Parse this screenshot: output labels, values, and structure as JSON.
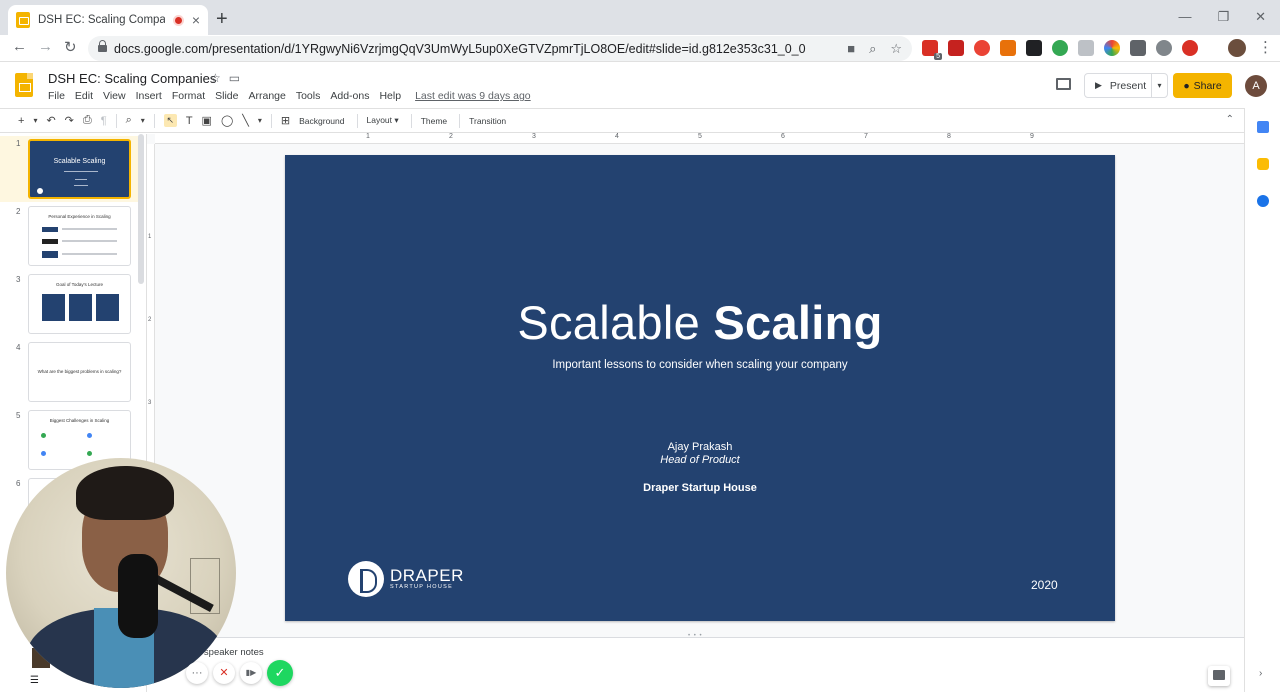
{
  "browser": {
    "tab_title": "DSH EC: Scaling Companies",
    "tab_close": "×",
    "new_tab": "+",
    "window_controls": [
      "—",
      "❐",
      "✕"
    ],
    "nav": {
      "back": "←",
      "forward": "→",
      "reload": "↻"
    },
    "url": "docs.google.com/presentation/d/1YRgwyNi6VzrjmgQqV3UmWyL5up0XeGTVZpmrTjLO8OE/edit#slide=id.g812e353c31_0_0",
    "omnibox_icons": [
      "■",
      "⌕",
      "☆"
    ],
    "extension_badge": "5",
    "menu": "⋮"
  },
  "app": {
    "doc_title": "DSH EC: Scaling Companies",
    "star": "☆",
    "folder": "▭",
    "menus": [
      "File",
      "Edit",
      "View",
      "Insert",
      "Format",
      "Slide",
      "Arrange",
      "Tools",
      "Add-ons",
      "Help"
    ],
    "last_edit": "Last edit was 9 days ago",
    "present_label": "Present",
    "present_caret": "▾",
    "share_label": "Share",
    "avatar_initial": "A"
  },
  "toolbar": {
    "icons": [
      "+",
      "▾",
      "↶",
      "↷",
      "⎙",
      "¶",
      "⌕",
      "▾"
    ],
    "select_tool": "↖",
    "shape_icons": [
      "T",
      "▣",
      "◯",
      "╲",
      "▾",
      "⊞"
    ],
    "background": "Background",
    "layout": "Layout",
    "theme": "Theme",
    "transition": "Transition",
    "collapse": "⌃"
  },
  "filmstrip": {
    "slides": [
      {
        "num": "1",
        "title": "Scalable Scaling"
      },
      {
        "num": "2",
        "title": "Personal Experience in Scaling"
      },
      {
        "num": "3",
        "title": "Goal of Today's Lecture"
      },
      {
        "num": "4",
        "title": "What are the biggest problems in scaling?"
      },
      {
        "num": "5",
        "title": "Biggest Challenges in Scaling"
      },
      {
        "num": "6",
        "title": ""
      }
    ]
  },
  "ruler": {
    "h": [
      "1",
      "2",
      "3",
      "4",
      "5",
      "6",
      "7",
      "8",
      "9"
    ],
    "v": [
      "1",
      "2",
      "3"
    ]
  },
  "slide": {
    "title_light": "Scalable",
    "title_bold": "Scaling",
    "subtitle": "Important lessons to consider when scaling your company",
    "author": "Ajay Prakash",
    "role": "Head of Product",
    "company": "Draper Startup House",
    "logo_main": "DRAPER",
    "logo_sub": "STARTUP HOUSE",
    "year": "2020",
    "background_color": "#234270"
  },
  "notes": {
    "placeholder": "d speaker notes",
    "grip": "• • •"
  },
  "recording": {
    "more": "···",
    "cancel": "✕",
    "pause": "▮▶",
    "done": "✓"
  },
  "side_panel": {
    "expand": "›"
  },
  "bottom_left": {
    "grid_icon": "☰"
  },
  "colors": {
    "slides_yellow": "#f4b400",
    "slide_navy": "#234270",
    "record_red": "#d93025",
    "done_green": "#1ed760"
  }
}
